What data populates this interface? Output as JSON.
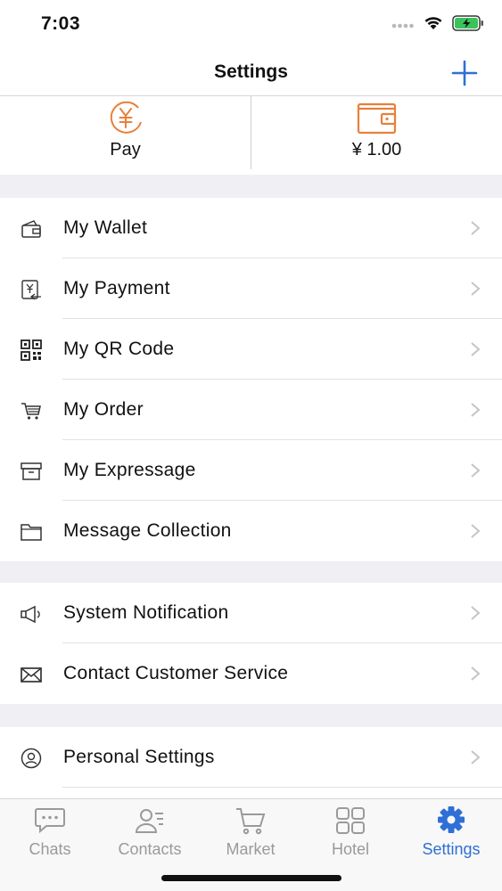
{
  "status": {
    "time": "7:03"
  },
  "nav": {
    "title": "Settings"
  },
  "top": {
    "pay_label": "Pay",
    "balance": "¥ 1.00"
  },
  "groups": [
    {
      "items": [
        {
          "label": "My Wallet",
          "icon": "wallet-icon"
        },
        {
          "label": "My Payment",
          "icon": "payment-icon"
        },
        {
          "label": "My QR Code",
          "icon": "qr-code-icon"
        },
        {
          "label": "My Order",
          "icon": "cart-icon"
        },
        {
          "label": "My Expressage",
          "icon": "box-icon"
        },
        {
          "label": "Message Collection",
          "icon": "folder-icon"
        }
      ]
    },
    {
      "items": [
        {
          "label": "System Notification",
          "icon": "megaphone-icon"
        },
        {
          "label": "Contact Customer Service",
          "icon": "envelope-icon"
        }
      ]
    },
    {
      "items": [
        {
          "label": "Personal Settings",
          "icon": "user-circle-icon"
        }
      ]
    }
  ],
  "tabs": [
    {
      "label": "Chats",
      "icon": "chat-bubble-icon",
      "active": false
    },
    {
      "label": "Contacts",
      "icon": "contacts-icon",
      "active": false
    },
    {
      "label": "Market",
      "icon": "shopping-cart-icon",
      "active": false
    },
    {
      "label": "Hotel",
      "icon": "grid-icon",
      "active": false
    },
    {
      "label": "Settings",
      "icon": "gear-icon",
      "active": true
    }
  ],
  "colors": {
    "accent": "#2f6fd6",
    "orange": "#e8803a",
    "tab_inactive": "#9a9a9a",
    "group_gap": "#efeff4"
  }
}
